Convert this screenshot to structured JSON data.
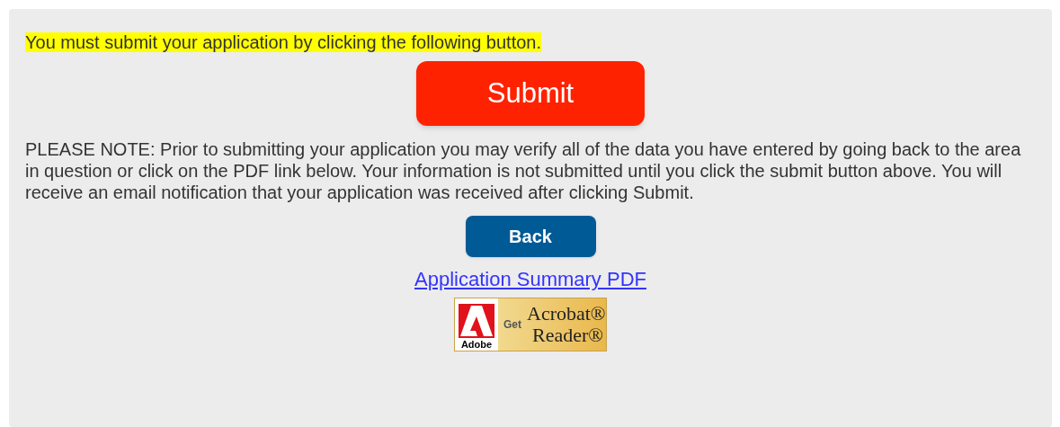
{
  "notice": "You must submit your application by clicking the following button.",
  "submit_button": "Submit",
  "note": "PLEASE NOTE: Prior to submitting your application you may verify all of the data you have entered by going back to the area in question or click on the PDF link below. Your information is not submitted until you click the submit button above. You will receive an email notification that your application was received after clicking Submit.",
  "back_button": "Back",
  "summary_link": "Application Summary PDF",
  "reader_badge": {
    "brand": "Adobe",
    "prefix": "Get",
    "title": "Acrobat®",
    "subtitle": "Reader®"
  }
}
